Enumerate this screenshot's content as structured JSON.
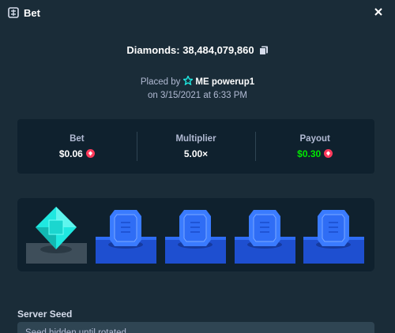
{
  "header": {
    "title": "Bet"
  },
  "diamonds": {
    "text": "Diamonds: 38,484,079,860"
  },
  "placed": {
    "prefix": "Placed by",
    "username": "ME powerup1",
    "date": "on 3/15/2021 at 6:33 PM"
  },
  "stats": {
    "bet_label": "Bet",
    "bet_value": "$0.06",
    "multiplier_label": "Multiplier",
    "multiplier_value": "5.00×",
    "payout_label": "Payout",
    "payout_value": "$0.30"
  },
  "board": {
    "tiles": [
      "cyan-diamond",
      "blue-sapphire",
      "blue-sapphire",
      "blue-sapphire",
      "blue-sapphire"
    ]
  },
  "server_seed": {
    "label": "Server Seed",
    "placeholder": "Seed hidden until rotated"
  },
  "colors": {
    "background": "#1a2c38",
    "panel": "#0f212e",
    "accent_green": "#00e701",
    "accent_cyan": "#1fe8e0",
    "accent_blue": "#2f6df5"
  }
}
